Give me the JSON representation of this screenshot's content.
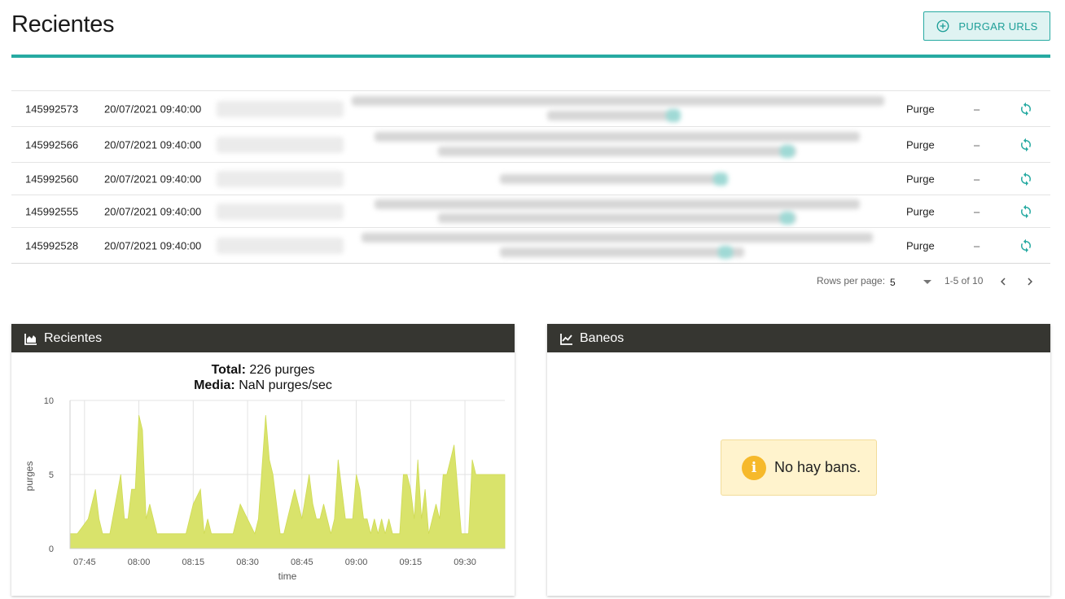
{
  "header": {
    "title": "Recientes",
    "purge_button": "PURGAR URLS"
  },
  "table": {
    "rows": [
      {
        "id": "145992573",
        "date": "20/07/2021 09:40:00",
        "type": "Purge",
        "status": "–"
      },
      {
        "id": "145992566",
        "date": "20/07/2021 09:40:00",
        "type": "Purge",
        "status": "–"
      },
      {
        "id": "145992560",
        "date": "20/07/2021 09:40:00",
        "type": "Purge",
        "status": "–"
      },
      {
        "id": "145992555",
        "date": "20/07/2021 09:40:00",
        "type": "Purge",
        "status": "–"
      },
      {
        "id": "145992528",
        "date": "20/07/2021 09:40:00",
        "type": "Purge",
        "status": "–"
      }
    ]
  },
  "pagination": {
    "rows_label": "Rows per page:",
    "rows_value": "5",
    "range": "1-5 of 10"
  },
  "recientes_card": {
    "title": "Recientes",
    "total_label": "Total:",
    "total_value": "226 purges",
    "media_label": "Media:",
    "media_value": "NaN purges/sec"
  },
  "baneos_card": {
    "title": "Baneos",
    "empty_message": "No hay bans."
  },
  "colors": {
    "accent": "#27aaa2",
    "card_header": "#363631",
    "area_fill": "#d9e36b",
    "warning": "#f6b92b"
  },
  "chart_data": {
    "type": "area",
    "xlabel": "time",
    "ylabel": "purges",
    "ylim": [
      0,
      10
    ],
    "yticks": [
      "0",
      "5",
      "10"
    ],
    "xticks": [
      "07:45",
      "08:00",
      "08:15",
      "08:30",
      "08:45",
      "09:00",
      "09:15",
      "09:30"
    ],
    "x_start": "07:41",
    "x_end": "09:41",
    "grid": true,
    "series": [
      {
        "minute_offset": [
          0,
          2,
          5,
          7,
          8,
          9,
          11,
          14,
          15,
          16,
          17,
          18,
          19,
          20,
          21,
          22,
          23,
          24,
          26,
          32,
          34,
          36,
          37,
          38,
          39,
          41,
          43,
          45,
          47,
          51,
          52,
          54,
          55,
          56,
          58,
          59,
          60,
          62,
          64,
          66,
          67,
          68,
          69,
          70,
          71,
          72,
          73,
          74,
          75,
          76,
          77,
          78,
          79,
          80,
          81,
          82,
          83,
          84,
          85,
          86,
          87,
          88,
          89,
          90,
          91,
          92,
          93,
          94,
          95,
          96,
          97,
          98,
          99,
          100,
          101,
          102,
          103,
          104,
          105,
          106,
          107,
          108,
          109,
          110,
          111,
          112,
          113,
          114,
          115,
          116,
          117,
          118,
          119,
          120
        ],
        "values": [
          1,
          1,
          2,
          4,
          2,
          1,
          1,
          5,
          2,
          2,
          4,
          4,
          9,
          8,
          2,
          3,
          2,
          1,
          1,
          1,
          3,
          4,
          1,
          2,
          1,
          1,
          1,
          1,
          3,
          1,
          2,
          9,
          6,
          5,
          1,
          1,
          2,
          4,
          2,
          5,
          3,
          2,
          2,
          3,
          2,
          1,
          2,
          6,
          4,
          2,
          2,
          2,
          5,
          4,
          2,
          2,
          1,
          2,
          1,
          2,
          1,
          2,
          1,
          1,
          1,
          5,
          5,
          4,
          2,
          6,
          2,
          4,
          1,
          2,
          3,
          2,
          5,
          5,
          6,
          7,
          4,
          1,
          1,
          1,
          6,
          5,
          5,
          5,
          5,
          5,
          5,
          5,
          5,
          5
        ]
      }
    ]
  }
}
